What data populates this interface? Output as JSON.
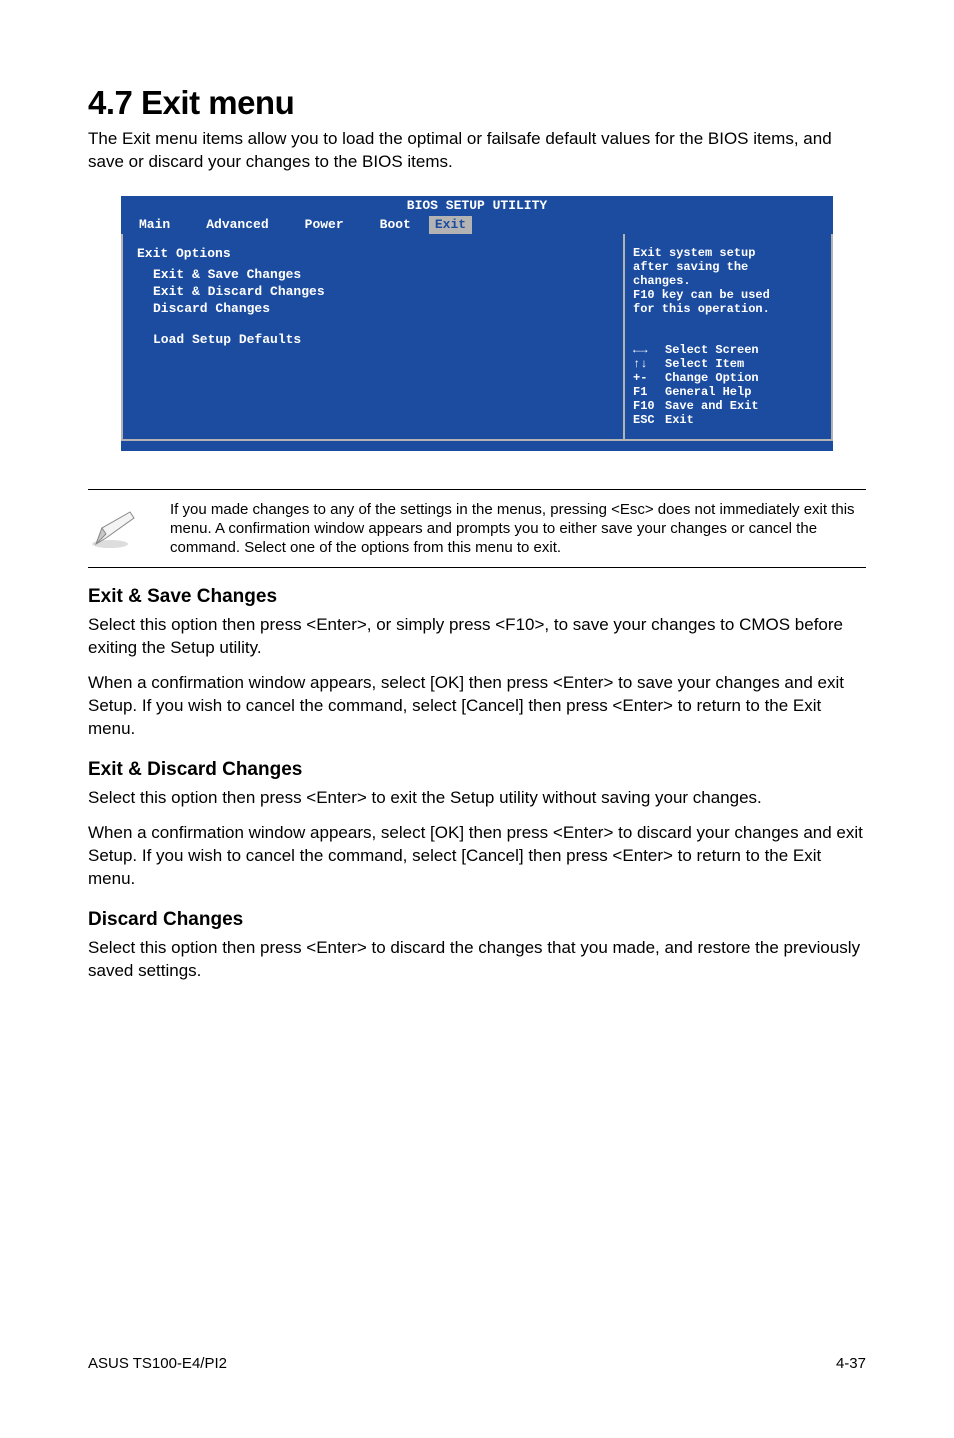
{
  "heading": "4.7 Exit menu",
  "lead": "The Exit menu items allow you to load the optimal or failsafe default values for the BIOS items, and save or discard your changes to the BIOS items.",
  "bios": {
    "title": "BIOS SETUP UTILITY",
    "tabs": [
      "Main",
      "Advanced",
      "Power",
      "Boot",
      "Exit"
    ],
    "options_header": "Exit Options",
    "options": [
      "Exit & Save Changes",
      "Exit & Discard Changes",
      "Discard Changes",
      "Load Setup Defaults"
    ],
    "right_top": [
      "Exit system setup",
      "after saving the",
      "changes.",
      "",
      "F10 key can be used",
      "for this operation."
    ],
    "help": [
      {
        "k": "←→",
        "t": "Select Screen"
      },
      {
        "k": "↑↓",
        "t": "Select Item"
      },
      {
        "k": "+-",
        "t": "Change Option"
      },
      {
        "k": "F1",
        "t": "General Help"
      },
      {
        "k": "F10",
        "t": "Save and Exit"
      },
      {
        "k": "ESC",
        "t": "Exit"
      }
    ]
  },
  "note": "If you made changes to any of the settings in the menus, pressing <Esc> does not immediately exit this menu. A confirmation window appears and prompts you to either save your changes or cancel the command. Select one of the options from this menu to exit.",
  "sections": [
    {
      "title": "Exit & Save Changes",
      "paras": [
        "Select this option then press <Enter>, or simply press <F10>, to save your changes to CMOS before exiting the Setup utility.",
        "When a confirmation window appears, select [OK] then press <Enter> to save your changes and exit Setup. If you wish to cancel the command, select [Cancel] then press <Enter> to return to the Exit menu."
      ]
    },
    {
      "title": "Exit & Discard Changes",
      "paras": [
        "Select this option then press <Enter> to exit the Setup utility without saving your changes.",
        "When a confirmation window appears, select [OK] then press <Enter> to discard your changes and exit Setup. If you wish to cancel the command, select [Cancel] then press <Enter> to return to the Exit menu."
      ]
    },
    {
      "title": "Discard Changes",
      "paras": [
        "Select this option then press <Enter> to discard the changes that you made, and restore the previously saved settings."
      ]
    }
  ],
  "footer": {
    "left": "ASUS TS100-E4/PI2",
    "right": "4-37"
  }
}
